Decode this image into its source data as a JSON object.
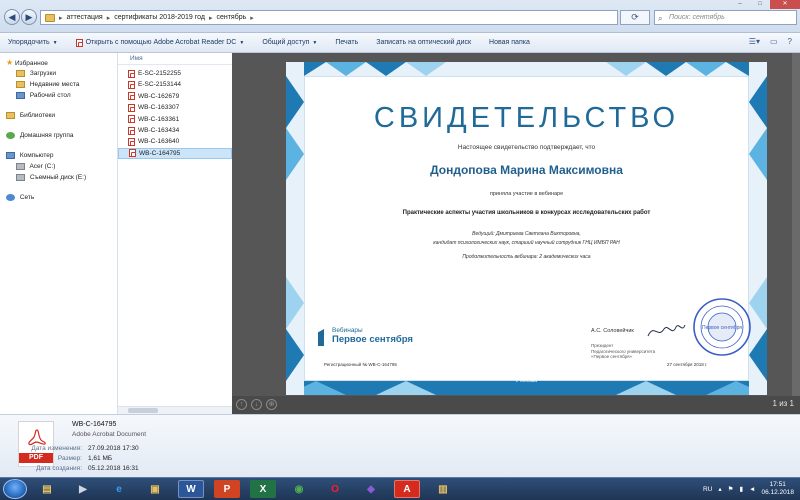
{
  "addressbar": {
    "path": [
      "аттестация",
      "сертификаты 2018-2019 год",
      "сентябрь"
    ],
    "search_placeholder": "Поиск: сентябрь"
  },
  "toolbar": {
    "organize": "Упорядочить",
    "open_with": "Открыть с помощью Adobe Acrobat Reader DC",
    "share": "Общий доступ",
    "print": "Печать",
    "burn": "Записать на оптический диск",
    "new_folder": "Новая папка"
  },
  "nav": {
    "favorites": "Избранное",
    "downloads": "Загрузки",
    "recent": "Недавние места",
    "desktop": "Рабочий стол",
    "libraries": "Библиотеки",
    "homegroup": "Домашняя группа",
    "computer": "Компьютер",
    "drive_c": "Acer (C:)",
    "drive_e": "Съемный диск (E:)",
    "network": "Сеть"
  },
  "files": {
    "column_name": "Имя",
    "items": [
      "E-SC-2152255",
      "E-SC-2153144",
      "WB-C-162679",
      "WB-C-163307",
      "WB-C-163361",
      "WB-C-163434",
      "WB-C-163640",
      "WB-C-164795"
    ],
    "selected_index": 7
  },
  "preview": {
    "page_count": "1 из 1",
    "certificate": {
      "title": "СВИДЕТЕЛЬСТВО",
      "subtitle": "Настоящее свидетельство подтверждает, что",
      "name": "Дондопова Марина Максимовна",
      "participated": "приняла участие в вебинаре",
      "webinar_title": "Практические аспекты участия школьников в конкурсах исследовательских работ",
      "host": "Ведущий: Дмитриева Светлана Викторовна,",
      "host_details": "кандидат психологических наук, старший научный сотрудник ГНЦ ИМБП РАН",
      "duration": "Продолжительность вебинара: 2 академических часа",
      "logo_small": "Вебинары",
      "logo_big": "Первое сентября",
      "signer": "А.С. Соловейчик",
      "signer_role_1": "Президент",
      "signer_role_2": "Педагогического университета",
      "signer_role_3": "«Первое сентября»",
      "reg_number": "Регистрационный № WB-C-164795",
      "date": "27 сентября 2018 г.",
      "city": "г. Москва",
      "seal_text": "Первое сентября"
    }
  },
  "details": {
    "filename": "WB-C-164795",
    "filetype": "Adobe Acrobat Document",
    "icon_label": "PDF",
    "modified_label": "Дата изменения:",
    "modified_value": "27.09.2018 17:30",
    "size_label": "Размер:",
    "size_value": "1,61 МБ",
    "created_label": "Дата создания:",
    "created_value": "05.12.2018 16:31"
  },
  "taskbar": {
    "language": "RU",
    "time": "17:51",
    "date": "06.12.2018"
  },
  "colors": {
    "accent_blue": "#1f6a98",
    "pdf_red": "#d42b1e",
    "selection": "#cce4f7"
  }
}
